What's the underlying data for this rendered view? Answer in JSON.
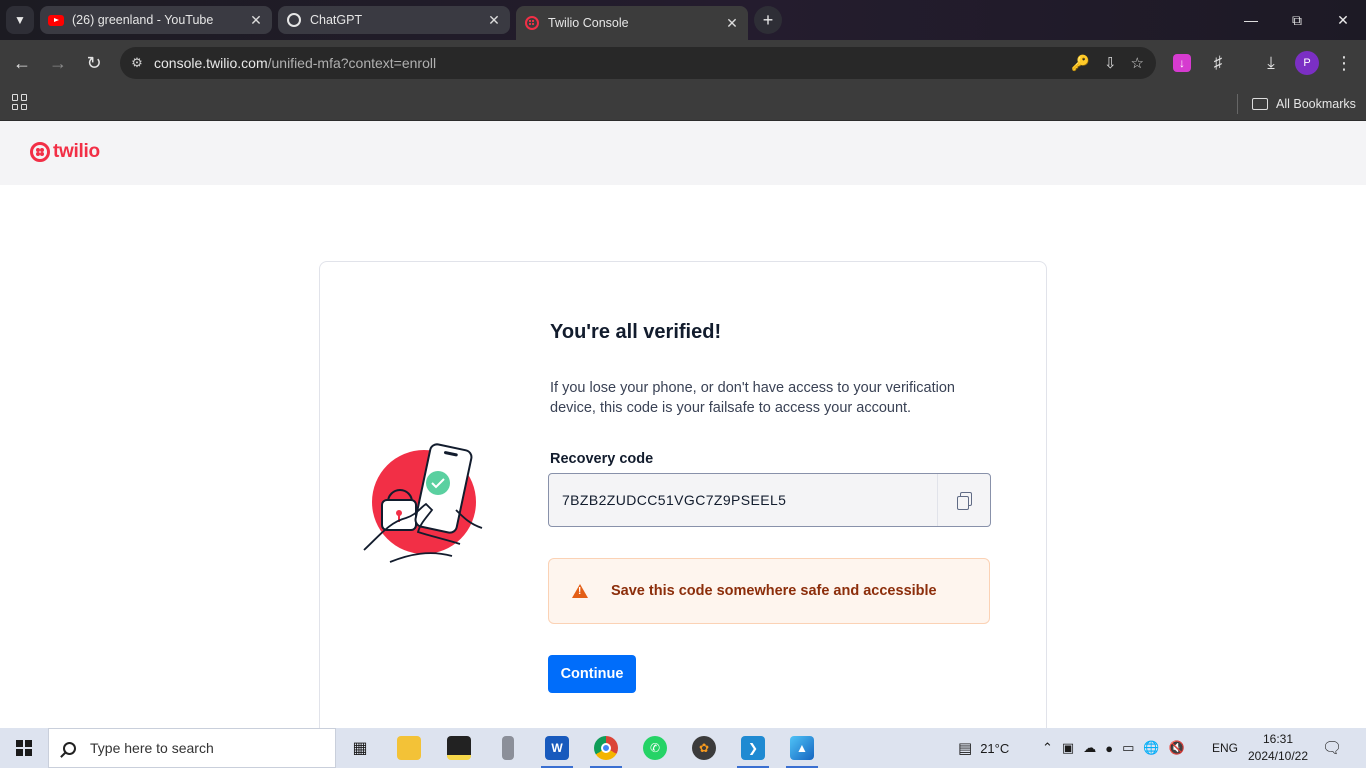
{
  "browser": {
    "tabs": [
      {
        "title": "(26) greenland - YouTube",
        "favicon": "youtube-icon"
      },
      {
        "title": "ChatGPT",
        "favicon": "chatgpt-icon"
      },
      {
        "title": "Twilio Console",
        "favicon": "twilio-icon",
        "active": true
      }
    ],
    "url_host": "console.twilio.com",
    "url_path": "/unified-mfa?context=enroll",
    "profile_initial": "P",
    "bookmarks_label": "All Bookmarks"
  },
  "header": {
    "logo_text": "twilio"
  },
  "verify": {
    "heading": "You're all verified!",
    "description": "If you lose your phone, or don't have access to your verification device, this code is your failsafe to access your account.",
    "code_label": "Recovery code",
    "code_value": "7BZB2ZUDCC51VGC7Z9PSEEL5",
    "warning": "Save this code somewhere safe and accessible",
    "continue_label": "Continue"
  },
  "taskbar": {
    "search_placeholder": "Type here to search",
    "weather": "21°C",
    "language": "ENG",
    "time": "16:31",
    "date": "2024/10/22"
  },
  "colors": {
    "brand": "#f22f46",
    "primary_button": "#006dfa",
    "warning": "#e35e16"
  }
}
